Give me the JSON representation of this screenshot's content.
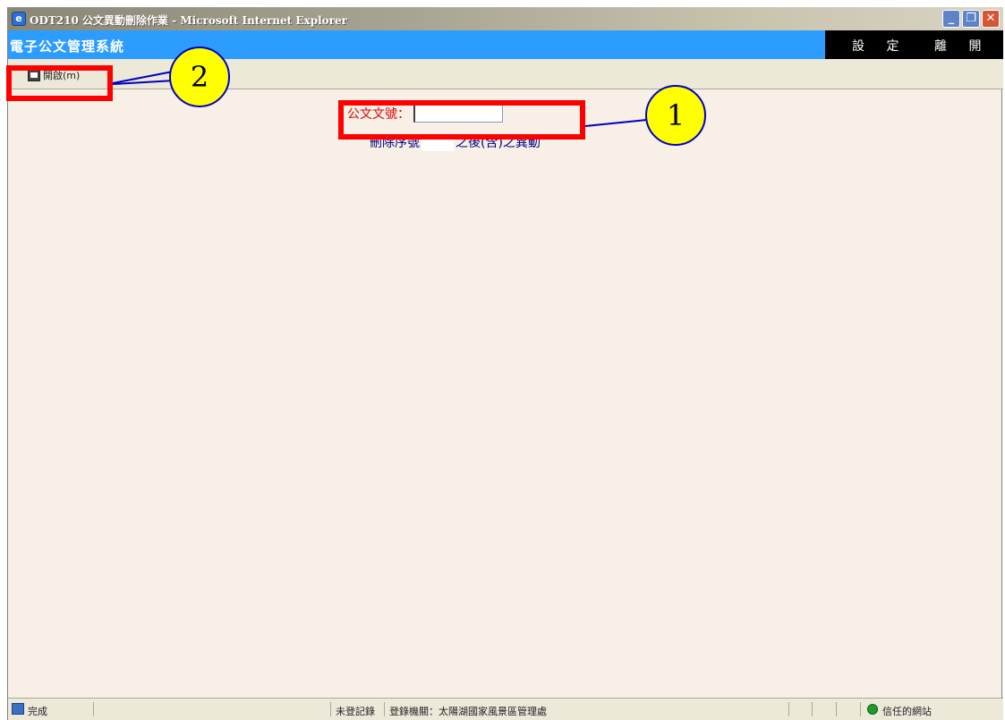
{
  "window": {
    "title": "ODT210 公文異動刪除作業 - Microsoft Internet Explorer",
    "min_glyph": "_",
    "max_glyph": "❐",
    "close_glyph": "✕"
  },
  "app": {
    "title": "電子公文管理系統",
    "menu": [
      "設 定",
      "離 開"
    ]
  },
  "toolbar": {
    "open_label": "開啟(m)"
  },
  "form": {
    "doc_label": "公文文號：",
    "doc_value": "",
    "delete_prefix": "刪除序號",
    "seq_value": "",
    "delete_suffix": "之後(含)之異動"
  },
  "annotations": {
    "callout1": "1",
    "callout2": "2"
  },
  "statusbar": {
    "status": "完成",
    "record": "未登記錄",
    "agency": "登錄機關：太陽湖國家風景區管理處",
    "zone": "信任的網站"
  },
  "colors": {
    "title_bar": "#a8a493",
    "app_bar": "#2d9cff",
    "content_bg": "#f8efe6",
    "annotation_red": "#ff0000",
    "callout_yellow": "#ffff00"
  },
  "icons": {
    "ie": "internet-explorer-icon",
    "open": "open-document-icon",
    "status": "page-icon",
    "zone": "trusted-site-icon"
  }
}
